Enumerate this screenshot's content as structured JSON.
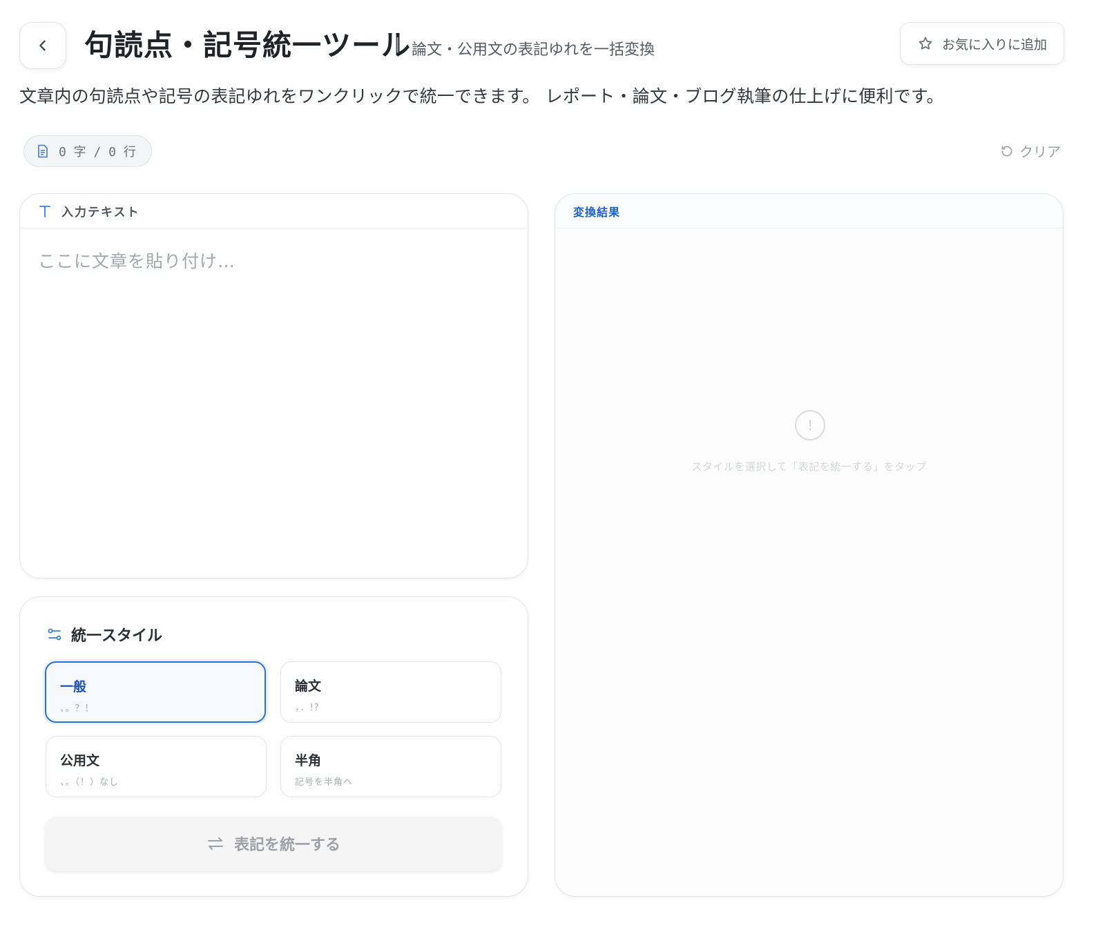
{
  "header": {
    "title": "句読点・記号統一ツール",
    "separator": "|",
    "subtitle": "論文・公用文の表記ゆれを一括変換",
    "favorite_label": "お気に入りに追加"
  },
  "description": "文章内の句読点や記号の表記ゆれをワンクリックで統一できます。 レポート・論文・ブログ執筆の仕上げに便利です。",
  "counter": {
    "text": "0 字 / 0 行"
  },
  "clear_label": "クリア",
  "input": {
    "label": "入力テキスト",
    "placeholder": "ここに文章を貼り付け…",
    "value": ""
  },
  "style_panel": {
    "heading": "統一スタイル",
    "options": [
      {
        "name": "一般",
        "sample": "、。？！",
        "selected": true
      },
      {
        "name": "論文",
        "sample": "，．!?",
        "selected": false
      },
      {
        "name": "公用文",
        "sample": "、。（！）なし",
        "selected": false
      },
      {
        "name": "半角",
        "sample": "記号を半角へ",
        "selected": false
      }
    ],
    "convert_label": "表記を統一する"
  },
  "result": {
    "label": "変換結果",
    "empty_icon": "!",
    "empty_message": "スタイルを選択して「表記を統一する」をタップ"
  },
  "colors": {
    "accent": "#2f6fdb",
    "result_label": "#1f5fd4",
    "border": "#e3e5e8"
  },
  "icons": [
    "back-chevron-icon",
    "star-icon",
    "document-icon",
    "refresh-icon",
    "text-type-icon",
    "sliders-icon",
    "swap-arrows-icon",
    "alert-circle-icon"
  ]
}
